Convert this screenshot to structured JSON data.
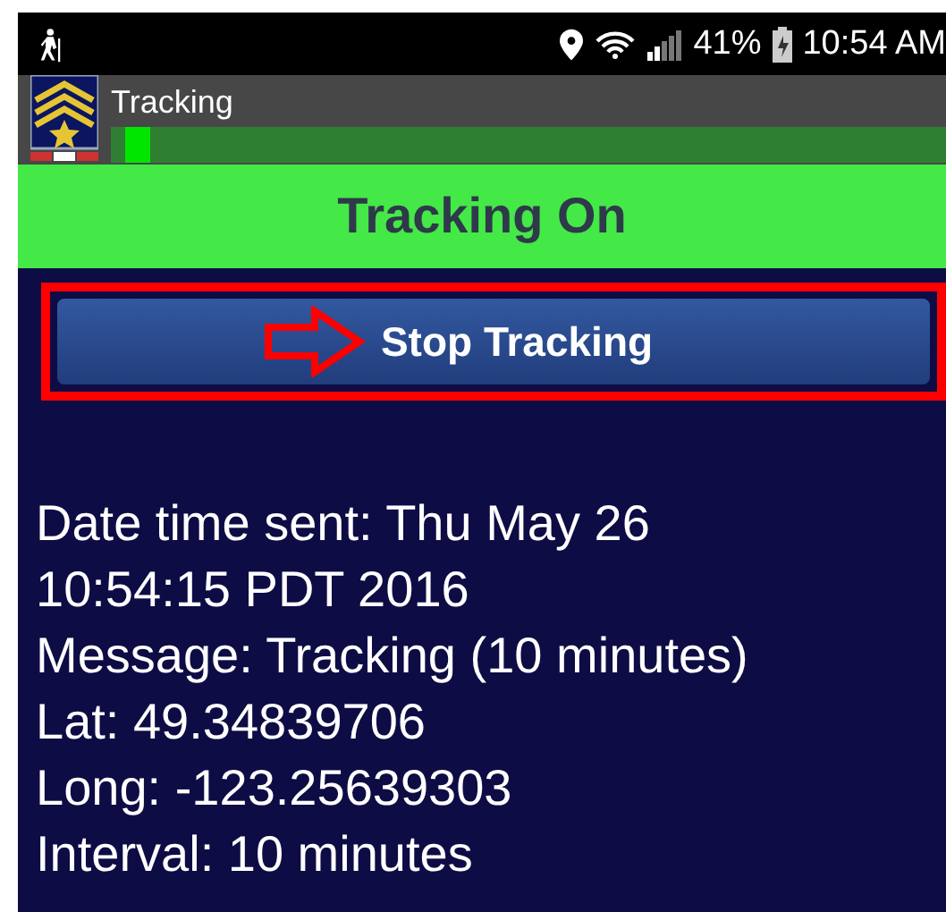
{
  "status_bar": {
    "battery": "41%",
    "time": "10:54 AM"
  },
  "app_bar": {
    "title": "Tracking",
    "progress": {
      "level": 0.03
    }
  },
  "banner": {
    "text": "Tracking On"
  },
  "button": {
    "label": "Stop Tracking",
    "highlighted": true
  },
  "info_lines": [
    "Date time sent: Thu May 26",
    "10:54:15 PDT 2016",
    "Message: Tracking (10 minutes)",
    "Lat: 49.34839706",
    "Long: -123.25639303",
    "Interval: 10 minutes"
  ]
}
